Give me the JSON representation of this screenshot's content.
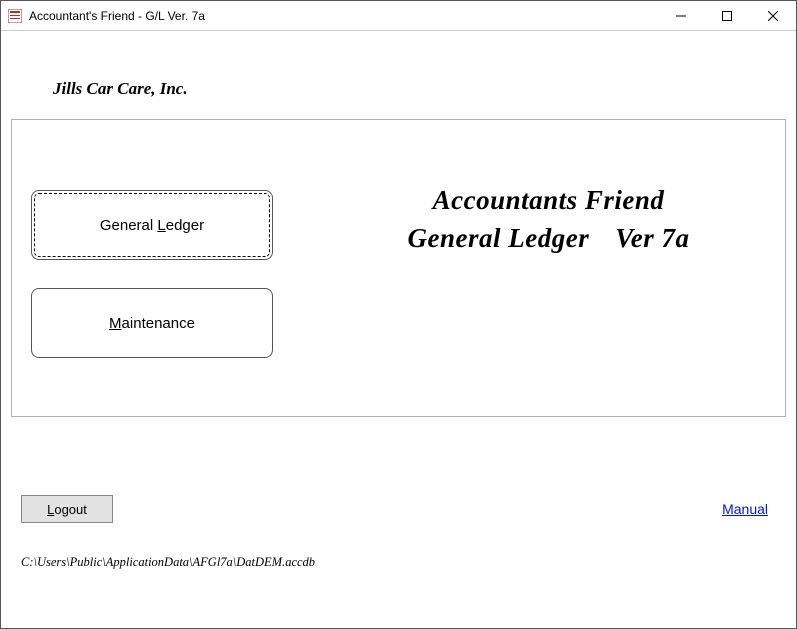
{
  "window": {
    "title": "Accountant's Friend -  G/L Ver. 7a"
  },
  "company": {
    "name": "Jills  Car Care, Inc."
  },
  "buttons": {
    "general_ledger_pre": "General ",
    "general_ledger_accel": "L",
    "general_ledger_post": "edger",
    "maintenance_accel": "M",
    "maintenance_post": "aintenance",
    "logout_accel": "L",
    "logout_post": "ogout"
  },
  "heading": {
    "line1": "Accountants Friend",
    "line2a": "General Ledger",
    "line2b": "Ver 7a"
  },
  "links": {
    "manual": "Manual"
  },
  "footer": {
    "db_path": "C:\\Users\\Public\\ApplicationData\\AFGl7a\\DatDEM.accdb"
  }
}
